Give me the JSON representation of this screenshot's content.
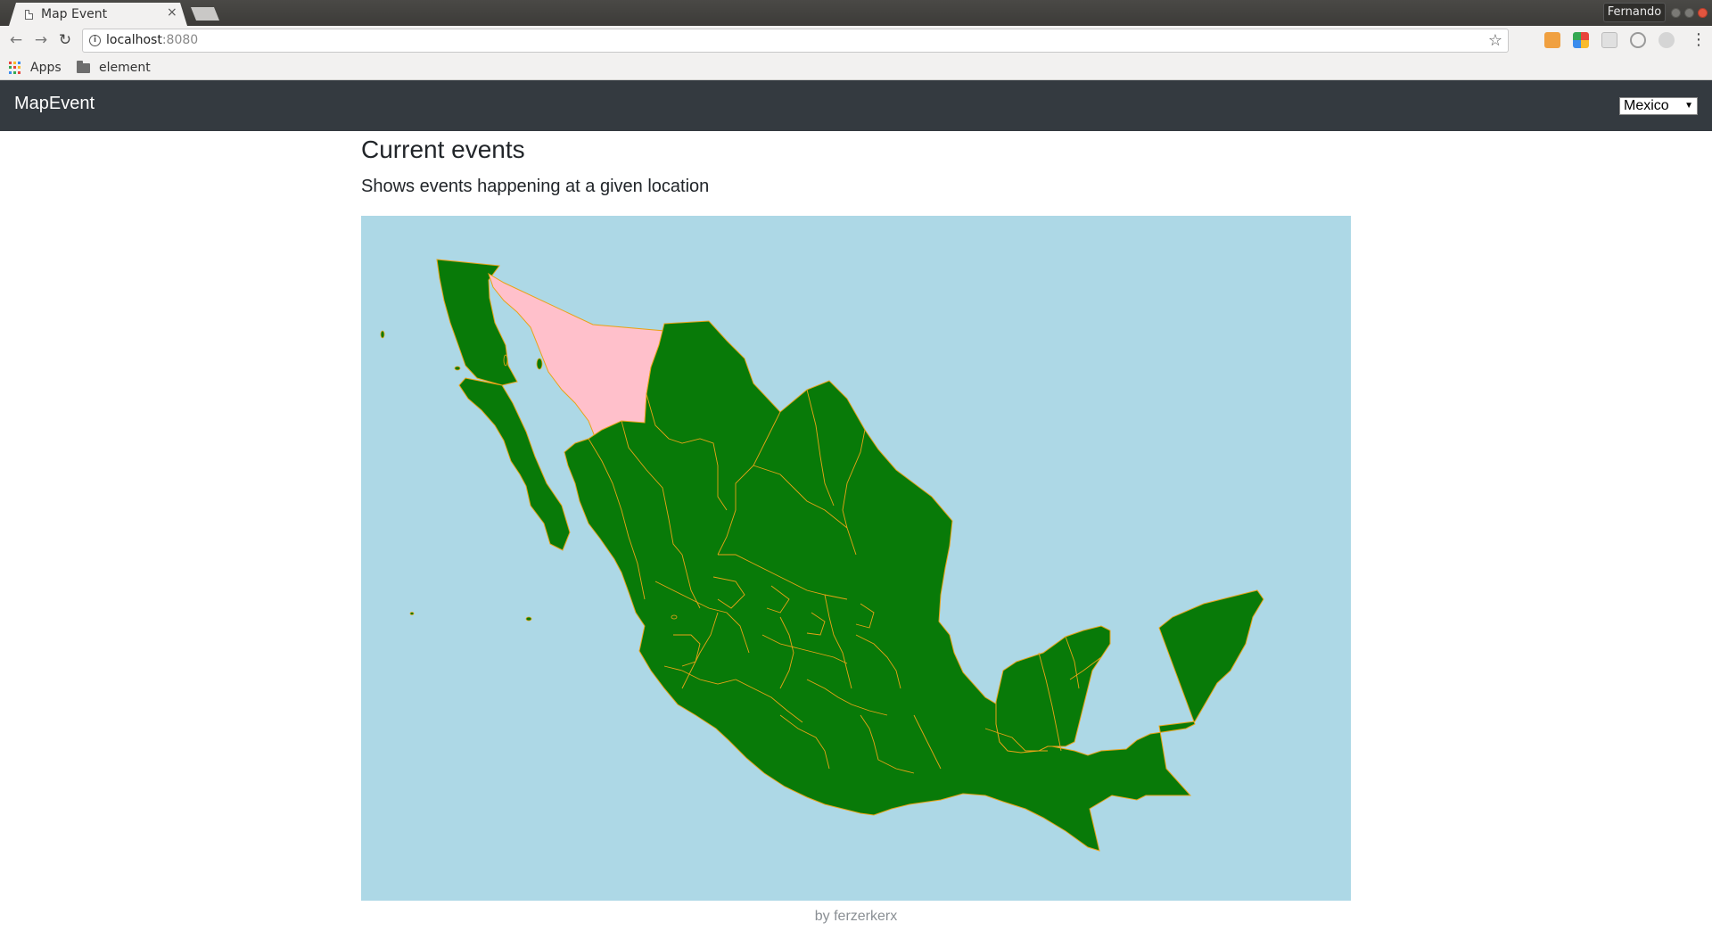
{
  "browser": {
    "tab_title": "Map Event",
    "tab_close": "×",
    "url_host": "localhost",
    "url_port": ":8080",
    "profile_name": "Fernando",
    "bookmarks": [
      {
        "label": "Apps",
        "icon": "apps-grid-icon"
      },
      {
        "label": "element",
        "icon": "folder-icon"
      }
    ]
  },
  "navbar": {
    "brand": "MapEvent",
    "country_select": {
      "selected": "Mexico"
    }
  },
  "main": {
    "title": "Current events",
    "subtitle": "Shows events happening at a given location",
    "map": {
      "country": "Mexico",
      "highlighted_region": "Sonora",
      "colors": {
        "water": "#add8e6",
        "land": "#087a08",
        "highlight": "#ffc0cb",
        "border": "#e8a317"
      }
    }
  },
  "footer": {
    "credit": "by ferzerkerx"
  }
}
